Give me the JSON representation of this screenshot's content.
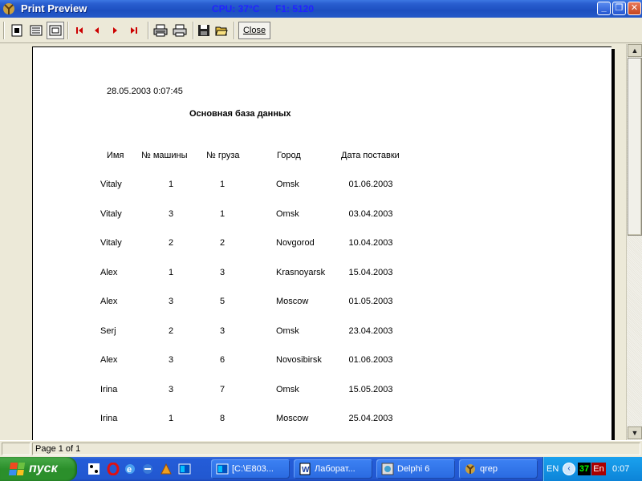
{
  "window": {
    "title": "Print Preview",
    "cpu_label": "CPU: 37°C",
    "f1_label": "F1: 5120"
  },
  "toolbar": {
    "close_label": "Close",
    "buttons": [
      "whole-page-icon",
      "page-width-icon",
      "100-percent-icon",
      "first-page-icon",
      "prev-page-icon",
      "next-page-icon",
      "last-page-icon",
      "print-setup-icon",
      "print-icon",
      "save-icon",
      "open-icon"
    ]
  },
  "report": {
    "timestamp": "28.05.2003 0:07:45",
    "title": "Основная база данных",
    "headers": [
      "Имя",
      "№ машины",
      "№ груза",
      "Город",
      "Дата поставки"
    ],
    "rows": [
      [
        "Vitaly",
        "1",
        "1",
        "Omsk",
        "01.06.2003"
      ],
      [
        "Vitaly",
        "3",
        "1",
        "Omsk",
        "03.04.2003"
      ],
      [
        "Vitaly",
        "2",
        "2",
        "Novgorod",
        "10.04.2003"
      ],
      [
        "Alex",
        "1",
        "3",
        "Krasnoyarsk",
        "15.04.2003"
      ],
      [
        "Alex",
        "3",
        "5",
        "Moscow",
        "01.05.2003"
      ],
      [
        "Serj",
        "2",
        "3",
        "Omsk",
        "23.04.2003"
      ],
      [
        "Alex",
        "3",
        "6",
        "Novosibirsk",
        "01.06.2003"
      ],
      [
        "Irina",
        "3",
        "7",
        "Omsk",
        "15.05.2003"
      ],
      [
        "Irina",
        "1",
        "8",
        "Moscow",
        "25.04.2003"
      ]
    ]
  },
  "status": {
    "page_info": "Page 1 of 1"
  },
  "taskbar": {
    "start_label": "пуск",
    "tasks": [
      {
        "label": "[C:\\E803...",
        "icon": "far-manager-icon"
      },
      {
        "label": "Лаборат...",
        "icon": "word-document-icon"
      },
      {
        "label": "Delphi 6",
        "icon": "delphi-icon"
      },
      {
        "label": "qrep",
        "icon": "delphi-app-icon"
      }
    ],
    "tray": {
      "lang": "EN",
      "temp": "37",
      "input_lang": "En",
      "clock": "0:07"
    }
  }
}
